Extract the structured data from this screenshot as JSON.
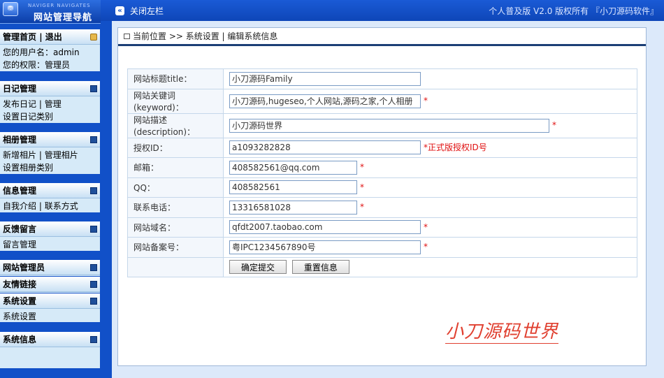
{
  "logo": {
    "badge": "⛃",
    "subtitle": "NAVIGER NAVIGATES",
    "title": "网站管理导航"
  },
  "header": {
    "toggle_label": "关闭左栏",
    "version": "个人普及版 V2.0  版权所有 『小刀源码软件』"
  },
  "sidebar": {
    "home": {
      "title": "管理首页",
      "sep": "|",
      "logout": "退出",
      "user_line": "您的用户名：admin",
      "role_line": "您的权限：管理员"
    },
    "diary": {
      "title": "日记管理",
      "item1": "发布日记",
      "sep": "|",
      "item2": "管理",
      "item3": "设置日记类别"
    },
    "album": {
      "title": "相册管理",
      "item1": "新增相片",
      "sep": "|",
      "item2": "管理相片",
      "item3": "设置相册类别"
    },
    "info": {
      "title": "信息管理",
      "item1": "自我介绍",
      "sep": "|",
      "item2": "联系方式"
    },
    "feedback": {
      "title": "反馈留言",
      "item1": "留言管理"
    },
    "admins": {
      "title": "网站管理员"
    },
    "links": {
      "title": "友情链接"
    },
    "settings": {
      "title": "系统设置",
      "item1": "系统设置"
    },
    "sysinfo": {
      "title": "系统信息"
    }
  },
  "breadcrumb": "当前位置 >> 系统设置 | 编辑系统信息",
  "form": {
    "title": {
      "label": "网站标题title：",
      "value": "小刀源码Family"
    },
    "keyword": {
      "label": "网站关键词(keyword)：",
      "value": "小刀源码,hugeseo,个人网站,源码之家,个人相册",
      "mark": "*"
    },
    "description": {
      "label": "网站描述(description)：",
      "value": "小刀源码世界",
      "mark": "*"
    },
    "license": {
      "label": "授权ID：",
      "value": "a1093282828",
      "note": "*正式版授权ID号"
    },
    "email": {
      "label": "邮箱：",
      "value": "408582561@qq.com",
      "mark": "*"
    },
    "qq": {
      "label": "QQ：",
      "value": "408582561",
      "mark": "*"
    },
    "phone": {
      "label": "联系电话：",
      "value": "13316581028",
      "mark": "*"
    },
    "domain": {
      "label": "网站域名：",
      "value": "qfdt2007.taobao.com",
      "mark": "*"
    },
    "icp": {
      "label": "网站备案号：",
      "value": "粤IPC1234567890号",
      "mark": "*"
    },
    "submit_label": "确定提交",
    "reset_label": "重置信息"
  },
  "watermark": "小刀源码世界"
}
